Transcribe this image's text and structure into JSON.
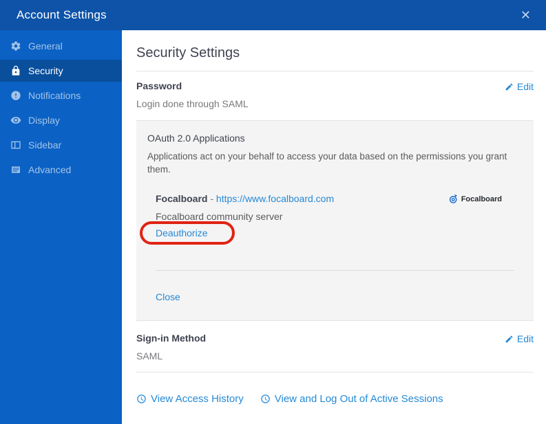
{
  "header": {
    "title": "Account Settings",
    "close_glyph": "✕"
  },
  "sidebar": {
    "items": [
      {
        "label": "General",
        "icon": "gear-icon",
        "active": false
      },
      {
        "label": "Security",
        "icon": "lock-icon",
        "active": true
      },
      {
        "label": "Notifications",
        "icon": "alert-circle-icon",
        "active": false
      },
      {
        "label": "Display",
        "icon": "eye-icon",
        "active": false
      },
      {
        "label": "Sidebar",
        "icon": "columns-icon",
        "active": false
      },
      {
        "label": "Advanced",
        "icon": "list-icon",
        "active": false
      }
    ]
  },
  "main": {
    "title": "Security Settings",
    "password": {
      "label": "Password",
      "value": "Login done through SAML",
      "edit_label": "Edit"
    },
    "oauth": {
      "title": "OAuth 2.0 Applications",
      "description": "Applications act on your behalf to access your data based on the permissions you grant them.",
      "app": {
        "name": "Focalboard",
        "separator": "-",
        "url": "https://www.focalboard.com",
        "logo_label": "Focalboard",
        "description": "Focalboard community server",
        "deauthorize_label": "Deauthorize"
      },
      "close_label": "Close"
    },
    "signin": {
      "label": "Sign-in Method",
      "value": "SAML",
      "edit_label": "Edit"
    },
    "footer_links": [
      {
        "label": "View Access History"
      },
      {
        "label": "View and Log Out of Active Sessions"
      }
    ]
  },
  "colors": {
    "header_bg": "#0e53a8",
    "sidebar_bg": "#0b61c4",
    "sidebar_active_bg": "#094f9c",
    "link_blue": "#2389d7",
    "annotation_red": "#e02314",
    "oauth_box_bg": "#f4f4f4"
  }
}
